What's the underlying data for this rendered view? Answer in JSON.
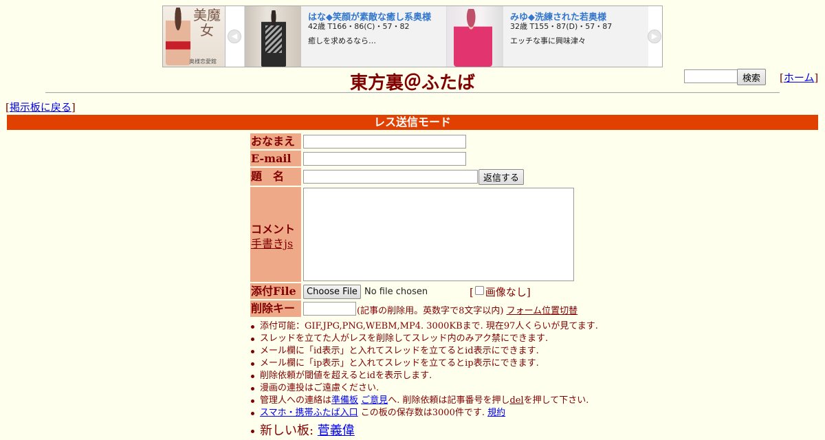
{
  "banner": {
    "logo": {
      "big_text": "美魔女",
      "side_text": "専門店",
      "small_text": "奥様恋愛館"
    },
    "prev_arrow": "◀",
    "next_arrow": "▶",
    "ads": [
      {
        "name": "はな◆笑顔が素敵な癒し系奥様",
        "spec": "42歳 T166・86(C)・57・82",
        "blurb": "癒しを求めるなら…"
      },
      {
        "name": "みゆ◆洗練された若奥様",
        "spec": "32歳 T155・87(D)・57・87",
        "blurb": "エッチな事に興味津々"
      }
    ]
  },
  "header": {
    "site_title": "東方裏＠ふたば",
    "search_button": "検索",
    "search_value": "",
    "home_link": "ホーム"
  },
  "back_link": "掲示板に戻る",
  "mode_bar": "レス送信モード",
  "form": {
    "name_label": "おなまえ",
    "email_label": "E-mail",
    "subject_label": "題　名",
    "reply_button": "返信する",
    "comment_label": "コメント",
    "handwrite_link": "手書きjs",
    "file_label": "添付File",
    "choose_file": "Choose File",
    "no_file": "No file chosen",
    "no_image": "画像なし",
    "delkey_label": "削除キー",
    "delkey_note": "(記事の削除用。英数字で8文字以内)",
    "form_switch": "フォーム位置切替",
    "values": {
      "name": "",
      "email": "",
      "subject": "",
      "comment": "",
      "delkey": ""
    }
  },
  "notes": {
    "n1": "添付可能：GIF,JPG,PNG,WEBM,MP4. 3000KBまで. 現在97人くらいが見てます.",
    "n2": "スレッドを立てた人がレスを削除してスレッド内のみアク禁にできます.",
    "n3": "メール欄に「id表示」と入れてスレッドを立てるとid表示にできます.",
    "n4": "メール欄に「ip表示」と入れてスレッドを立てるとip表示にできます.",
    "n5": "削除依頼が閾値を超えるとidを表示します.",
    "n6": "漫画の連投はご遠慮ください.",
    "n7_prefix": "管理人への連絡は",
    "n7_link1": "準備板",
    "n7_link2": "ご意見",
    "n7_mid": "へ. 削除依頼は記事番号を押し",
    "n7_link3": "del",
    "n7_suffix": "を押して下さい.",
    "n8_link": "スマホ・携帯ふたば入口",
    "n8_text": " この板の保存数は3000件です. ",
    "n8_link2": "規約",
    "n9_prefix": "新しい板: ",
    "n9_link": "菅義偉"
  },
  "colors": {
    "background": "#ffffee",
    "text": "#800000",
    "mode_bar": "#e04000",
    "label_bg": "#eeaa88",
    "ad_name": "#3377cc"
  }
}
